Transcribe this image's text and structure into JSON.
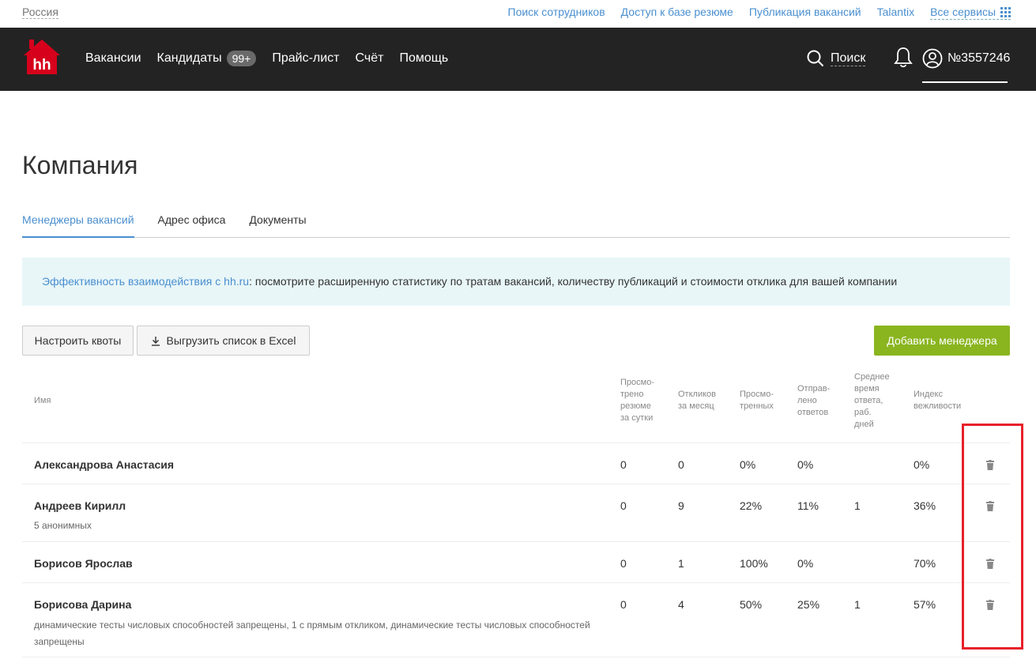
{
  "topbar": {
    "region": "Россия",
    "links": [
      "Поиск сотрудников",
      "Доступ к базе резюме",
      "Публикация вакансий",
      "Talantix"
    ],
    "all_services": "Все сервисы"
  },
  "nav": {
    "logo_text": "hh",
    "items": [
      "Вакансии",
      "Кандидаты",
      "Прайс-лист",
      "Счёт",
      "Помощь"
    ],
    "candidates_badge": "99+",
    "search_label": "Поиск",
    "account_number": "№3557246"
  },
  "page": {
    "title": "Компания",
    "tabs": [
      "Менеджеры вакансий",
      "Адрес офиса",
      "Документы"
    ],
    "active_tab": 0
  },
  "banner": {
    "link_text": "Эффективность взаимодействия с hh.ru",
    "text": ": посмотрите расширенную статистику по тратам вакансий, количеству публикаций и стоимости отклика для вашей компании"
  },
  "buttons": {
    "quotas": "Настроить квоты",
    "export_excel": "Выгрузить список в Excel",
    "add_manager": "Добавить менеджера"
  },
  "table": {
    "headers": {
      "name": "Имя",
      "viewed_per_day": [
        "Просмо-",
        "трено",
        "резюме",
        "за сутки"
      ],
      "responses_month": [
        "Откликов",
        "за месяц"
      ],
      "viewed": [
        "Просмо-",
        "тренных"
      ],
      "answered": [
        "Отправ-",
        "лено",
        "ответов"
      ],
      "avg_time": [
        "Среднее",
        "время",
        "ответа,",
        "раб.",
        "дней"
      ],
      "politeness": [
        "Индекс",
        "вежливости"
      ]
    },
    "rows": [
      {
        "name": "Александрова Анастасия",
        "sub": "",
        "viewed_day": "0",
        "responses": "0",
        "viewed_pct": "0%",
        "answered_pct": "0%",
        "avg": "",
        "politeness": "0%"
      },
      {
        "name": "Андреев Кирилл",
        "sub": "5 анонимных",
        "viewed_day": "0",
        "responses": "9",
        "viewed_pct": "22%",
        "answered_pct": "11%",
        "avg": "1",
        "politeness": "36%"
      },
      {
        "name": "Борисов Ярослав",
        "sub": "",
        "viewed_day": "0",
        "responses": "1",
        "viewed_pct": "100%",
        "answered_pct": "0%",
        "avg": "",
        "politeness": "70%"
      },
      {
        "name": "Борисова Дарина",
        "sub_line1": "динамические тесты числовых способностей запрещены, 1 с прямым откликом, динамические тесты числовых способностей",
        "sub_line2": "запрещены",
        "viewed_day": "0",
        "responses": "4",
        "viewed_pct": "50%",
        "answered_pct": "25%",
        "avg": "1",
        "politeness": "57%"
      }
    ]
  },
  "colors": {
    "nav_bg": "#232323",
    "link": "#4a8fcf",
    "add_button": "#8ab51f",
    "logo_red": "#d6001c",
    "highlight": "#e8202a"
  }
}
